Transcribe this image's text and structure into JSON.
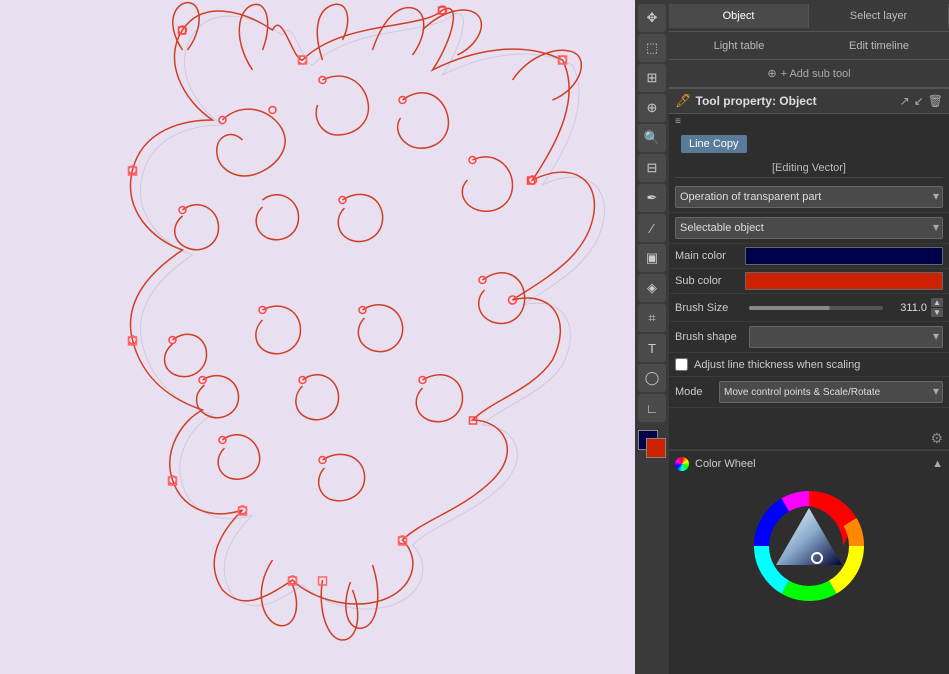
{
  "tabs": {
    "object_label": "Object",
    "select_layer_label": "Select layer",
    "light_table_label": "Light table",
    "edit_timeline_label": "Edit timeline",
    "add_sub_tool_label": "+ Add sub tool"
  },
  "tool_property": {
    "title": "Tool property: Object",
    "icon": "🖊",
    "line_copy_label": "Line Copy",
    "editing_vector_label": "[Editing Vector]",
    "operation_label": "Operation of transparent part",
    "selectable_object_label": "Selectable object",
    "main_color_label": "Main color",
    "sub_color_label": "Sub color",
    "brush_size_label": "Brush Size",
    "brush_size_value": "311.0",
    "brush_shape_label": "Brush shape",
    "adjust_line_label": "Adjust line thickness when scaling",
    "mode_label": "Mode",
    "mode_value": "Move control points & Scale/Rotate"
  },
  "color_wheel": {
    "title": "Color Wheel"
  },
  "toolbar_buttons": [
    {
      "name": "move-tool",
      "icon": "✥"
    },
    {
      "name": "select-tool",
      "icon": "⬚"
    },
    {
      "name": "layer-tool",
      "icon": "⊞"
    },
    {
      "name": "pen-tool",
      "icon": "✏"
    },
    {
      "name": "brush-tool",
      "icon": "🖌"
    },
    {
      "name": "fill-tool",
      "icon": "🪣"
    },
    {
      "name": "eraser-tool",
      "icon": "◻"
    },
    {
      "name": "gradient-tool",
      "icon": "▦"
    },
    {
      "name": "vector-tool",
      "icon": "⌖"
    },
    {
      "name": "text-tool",
      "icon": "T"
    },
    {
      "name": "balloon-tool",
      "icon": "◎"
    },
    {
      "name": "ruler-tool",
      "icon": "/"
    },
    {
      "name": "color-pick-tool",
      "icon": "△"
    }
  ]
}
